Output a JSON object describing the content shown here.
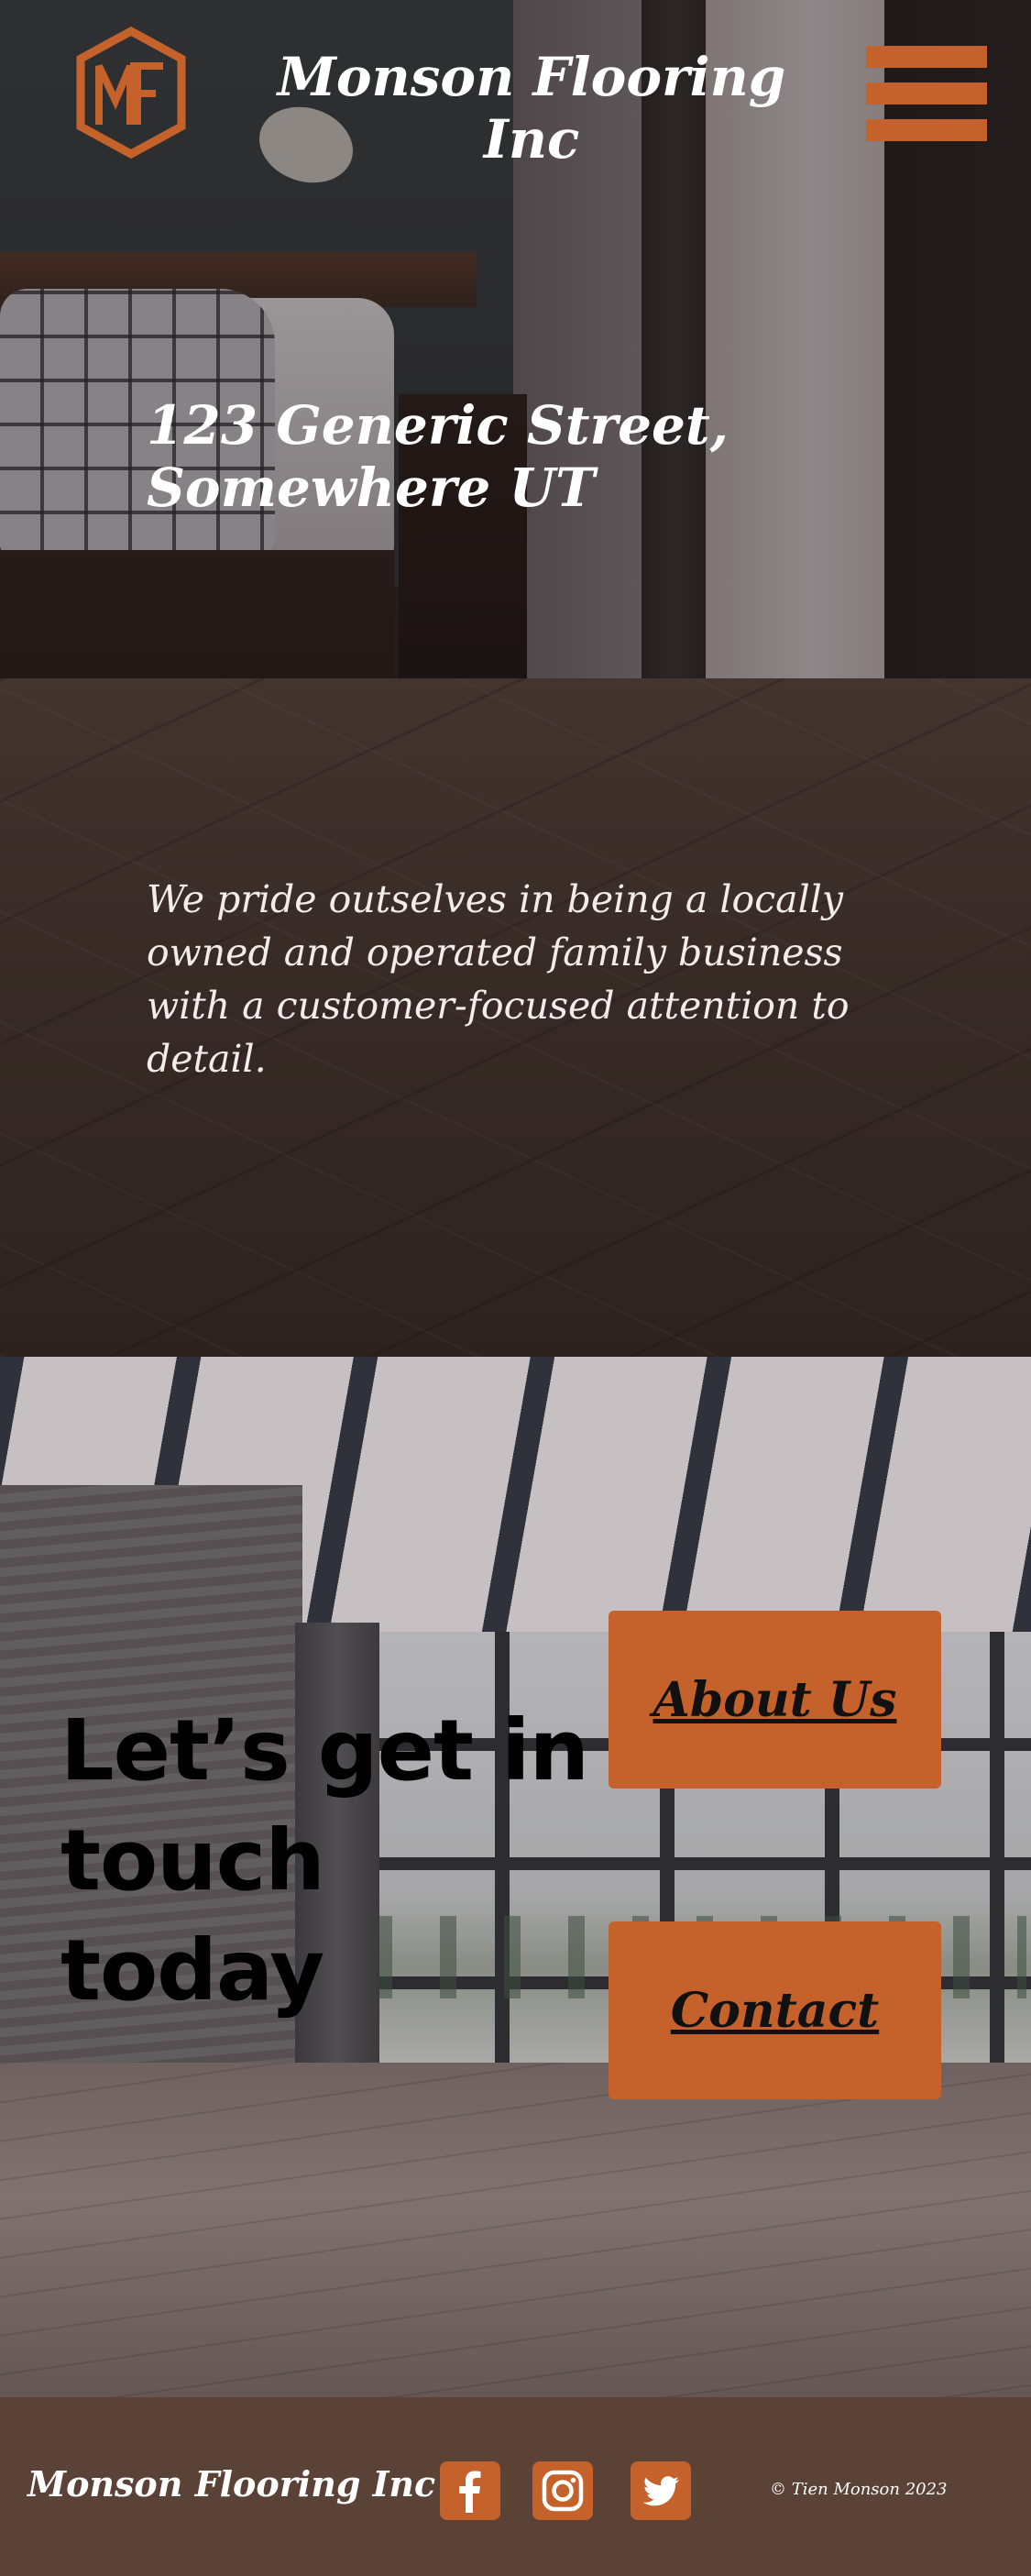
{
  "header": {
    "site_title": "Monson Flooring Inc",
    "logo_letters": "MF",
    "menu_icon": "hamburger-menu-icon"
  },
  "hero": {
    "address": "123 Generic Street, Somewhere UT",
    "tagline": "We pride outselves in being a locally owned and operated family business with a customer-focused attention to detail."
  },
  "contact": {
    "heading": "Let’s get in touch today",
    "about_label": "About Us",
    "contact_label": "Contact"
  },
  "footer": {
    "brand": "Monson Flooring Inc",
    "social": [
      "facebook-icon",
      "instagram-icon",
      "twitter-icon"
    ],
    "copyright": "© Tien Monson 2023"
  },
  "colors": {
    "accent": "#c5622b",
    "footer_bg": "#5a4237",
    "text_light": "#ffffff"
  }
}
